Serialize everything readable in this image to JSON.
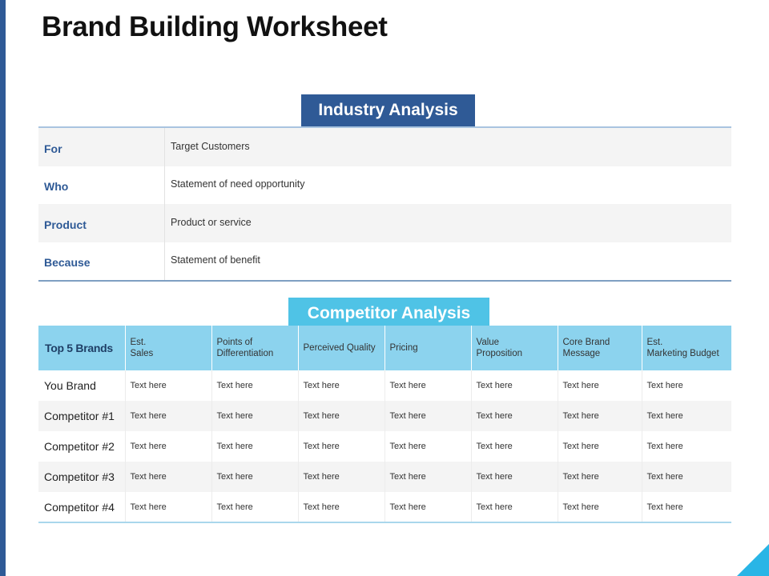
{
  "title": "Brand Building Worksheet",
  "industry": {
    "label": "Industry Analysis",
    "rows": [
      {
        "key": "For",
        "value": "Target Customers"
      },
      {
        "key": "Who",
        "value": "Statement of need opportunity"
      },
      {
        "key": "Product",
        "value": "Product or service"
      },
      {
        "key": "Because",
        "value": "Statement of benefit"
      }
    ]
  },
  "competitor": {
    "label": "Competitor Analysis",
    "headers": [
      "Top 5 Brands",
      "Est.\nSales",
      "Points of\nDifferentiation",
      "Perceived Quality",
      "Pricing",
      "Value\nProposition",
      "Core Brand\nMessage",
      "Est.\nMarketing Budget"
    ],
    "rows": [
      {
        "brand": "You Brand",
        "cells": [
          "Text here",
          "Text here",
          "Text here",
          "Text here",
          "Text here",
          "Text here",
          "Text here"
        ]
      },
      {
        "brand": "Competitor #1",
        "cells": [
          "Text here",
          "Text here",
          "Text here",
          "Text here",
          "Text here",
          "Text here",
          "Text here"
        ]
      },
      {
        "brand": "Competitor #2",
        "cells": [
          "Text here",
          "Text here",
          "Text here",
          "Text here",
          "Text here",
          "Text here",
          "Text here"
        ]
      },
      {
        "brand": "Competitor #3",
        "cells": [
          "Text here",
          "Text here",
          "Text here",
          "Text here",
          "Text here",
          "Text here",
          "Text here"
        ]
      },
      {
        "brand": "Competitor #4",
        "cells": [
          "Text here",
          "Text here",
          "Text here",
          "Text here",
          "Text here",
          "Text here",
          "Text here"
        ]
      }
    ]
  },
  "colors": {
    "brand_blue": "#2f5a96",
    "accent_cyan": "#4fc3e6",
    "header_cyan": "#8cd3ee"
  }
}
